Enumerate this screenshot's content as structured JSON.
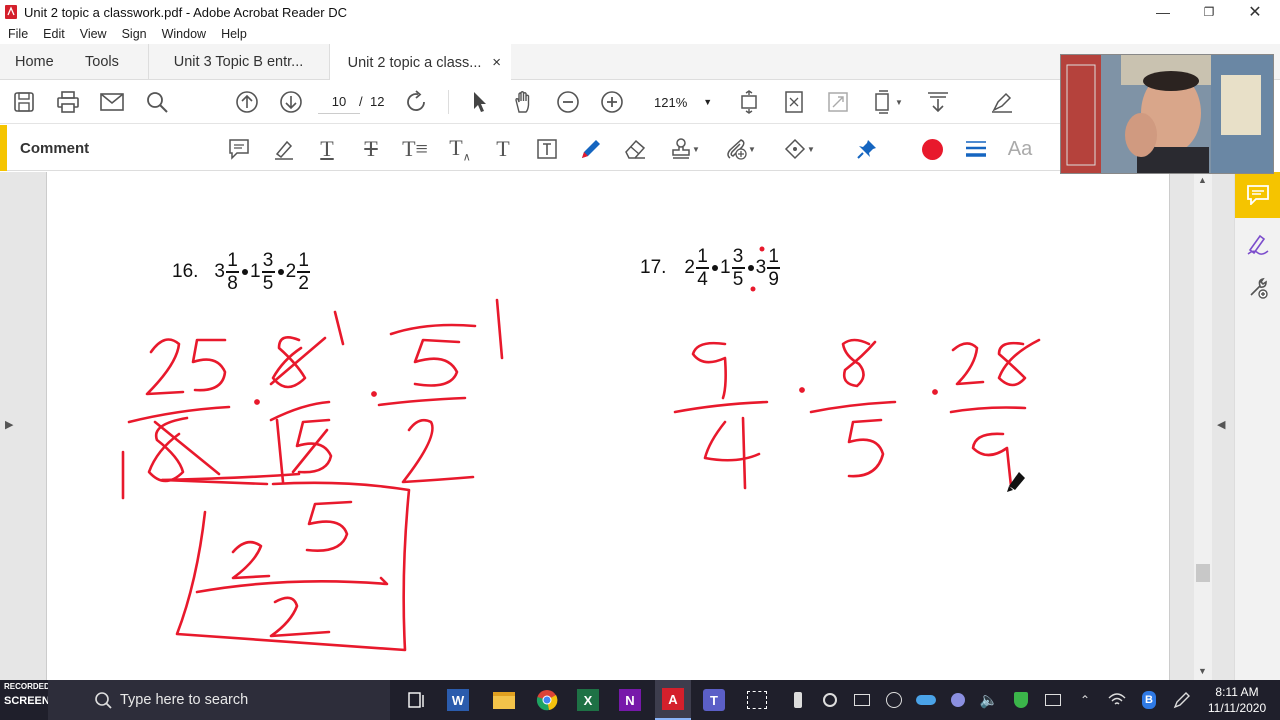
{
  "window": {
    "title": "Unit 2 topic a classwork.pdf - Adobe Acrobat Reader DC",
    "controls": [
      "minimize",
      "restore",
      "close"
    ]
  },
  "menu": {
    "items": [
      "File",
      "Edit",
      "View",
      "Sign",
      "Window",
      "Help"
    ]
  },
  "tabs": {
    "home": "Home",
    "tools": "Tools",
    "doc1": "Unit 3 Topic B entr...",
    "doc2": "Unit 2 topic a class...",
    "close": "×"
  },
  "toolbar": {
    "current_page": "10",
    "page_separator": "/",
    "total_pages": "12",
    "zoom": "121%"
  },
  "comment_bar": {
    "label": "Comment",
    "font_label": "Aa",
    "ink_color": "#e8192c"
  },
  "problems": {
    "p16": {
      "number": "16.",
      "terms": [
        {
          "whole": "3",
          "num": "1",
          "den": "8"
        },
        {
          "whole": "1",
          "num": "3",
          "den": "5"
        },
        {
          "whole": "2",
          "num": "1",
          "den": "2"
        }
      ]
    },
    "p17": {
      "number": "17.",
      "terms": [
        {
          "whole": "2",
          "num": "1",
          "den": "4"
        },
        {
          "whole": "1",
          "num": "3",
          "den": "5"
        },
        {
          "whole": "3",
          "num": "1",
          "den": "9"
        }
      ]
    }
  },
  "taskbar": {
    "search_placeholder": "Type here to search",
    "watermark_top": "RECORDED WITH",
    "watermark_brand": "SCREENCAST-O-MATIC",
    "time": "8:11 AM",
    "date": "11/11/2020"
  },
  "colors": {
    "accent_yellow": "#f5c400",
    "ink_red": "#e8192c",
    "taskbar": "#1f1f2b"
  }
}
